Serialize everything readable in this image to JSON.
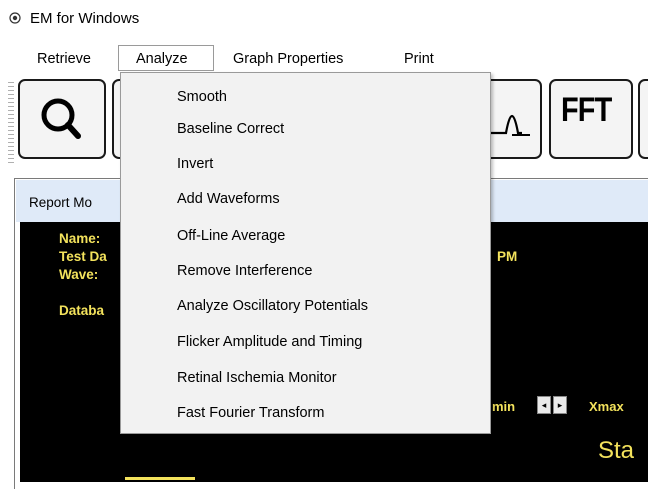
{
  "window": {
    "title": "EM for Windows"
  },
  "menubar": {
    "items": [
      {
        "label": "Retrieve"
      },
      {
        "label": "Analyze"
      },
      {
        "label": "Graph Properties"
      },
      {
        "label": "Print"
      }
    ]
  },
  "toolbar": {
    "buttons": [
      {
        "icon": "magnifier-icon"
      },
      {
        "icon": "waveform-icon"
      },
      {
        "label": "FFT"
      }
    ]
  },
  "analyze_menu": {
    "items": [
      "Smooth",
      "Baseline Correct",
      "Invert",
      "Add Waveforms",
      "Off-Line Average",
      "Remove Interference",
      "Analyze Oscillatory Potentials",
      "Flicker Amplitude and Timing",
      "Retinal Ischemia Monitor",
      "Fast Fourier Transform"
    ]
  },
  "report": {
    "title_partial": "Report Mo",
    "labels": {
      "name": "Name:",
      "test_date": "Test Da",
      "wave": "Wave:",
      "database": "Databa",
      "pm": "PM",
      "min": "min",
      "xmax": "Xmax",
      "start": "Sta"
    }
  },
  "colors": {
    "report_text": "#f3e25c",
    "report_background": "#000000",
    "report_header": "#dfeaf8"
  }
}
